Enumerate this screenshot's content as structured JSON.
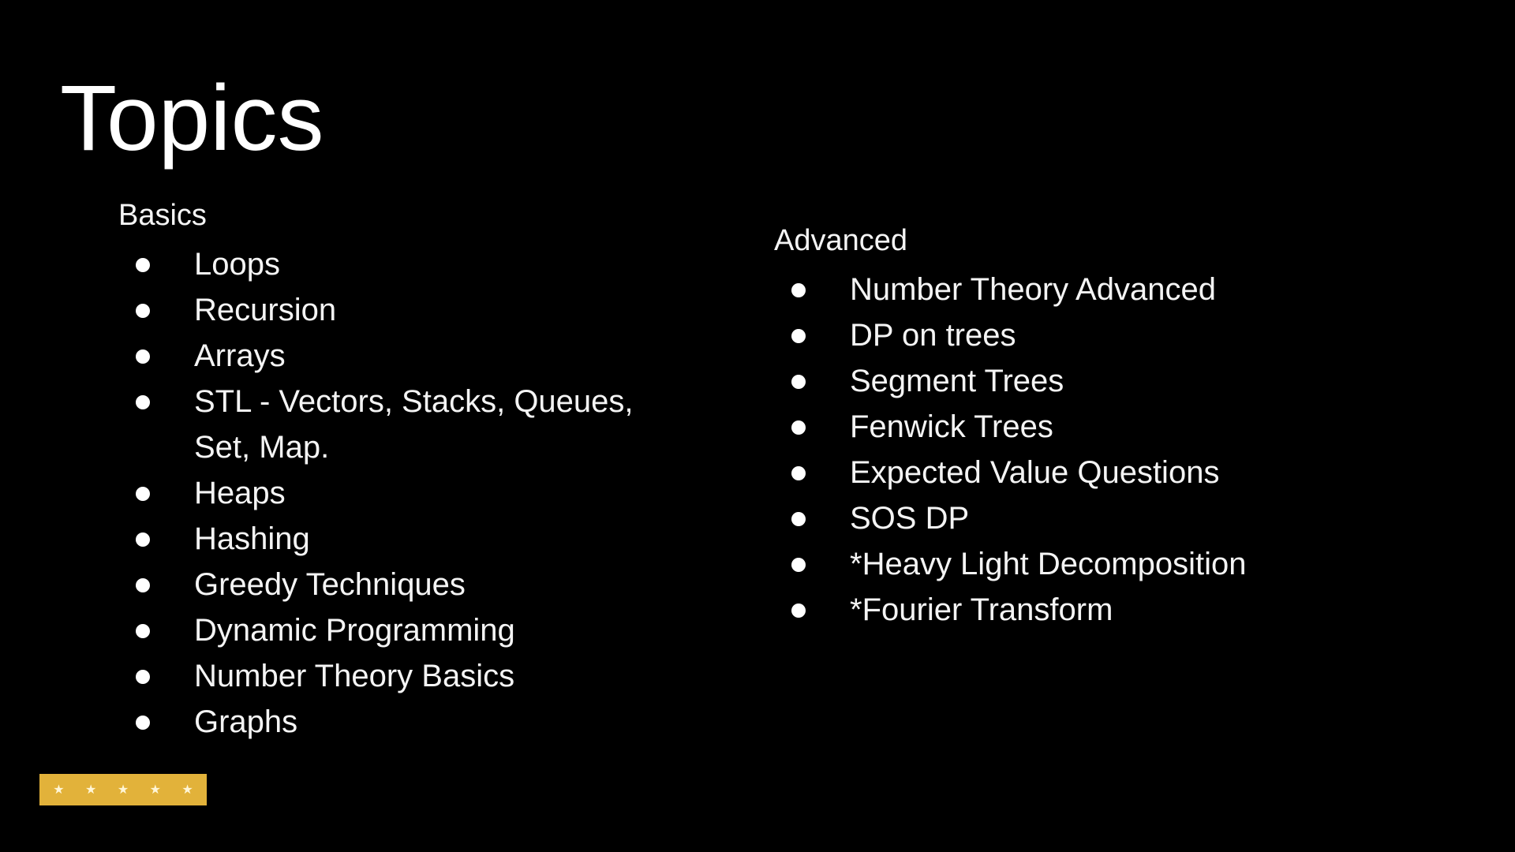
{
  "slide": {
    "title": "Topics",
    "basics": {
      "heading": "Basics",
      "items": [
        "Loops",
        "Recursion",
        "Arrays",
        "STL - Vectors, Stacks, Queues, Set, Map.",
        "Heaps",
        "Hashing",
        "Greedy Techniques",
        "Dynamic Programming",
        "Number Theory Basics",
        "Graphs"
      ]
    },
    "advanced": {
      "heading": "Advanced",
      "items": [
        "Number Theory Advanced",
        "DP on trees",
        "Segment Trees",
        "Fenwick Trees",
        "Expected Value Questions",
        "SOS DP",
        "*Heavy Light Decomposition",
        "*Fourier Transform"
      ]
    }
  },
  "rating": {
    "stars": 5,
    "max": 5,
    "icon": "star-icon",
    "color": "#e2b23a"
  },
  "colors": {
    "background": "#000000",
    "text": "#ffffff"
  }
}
